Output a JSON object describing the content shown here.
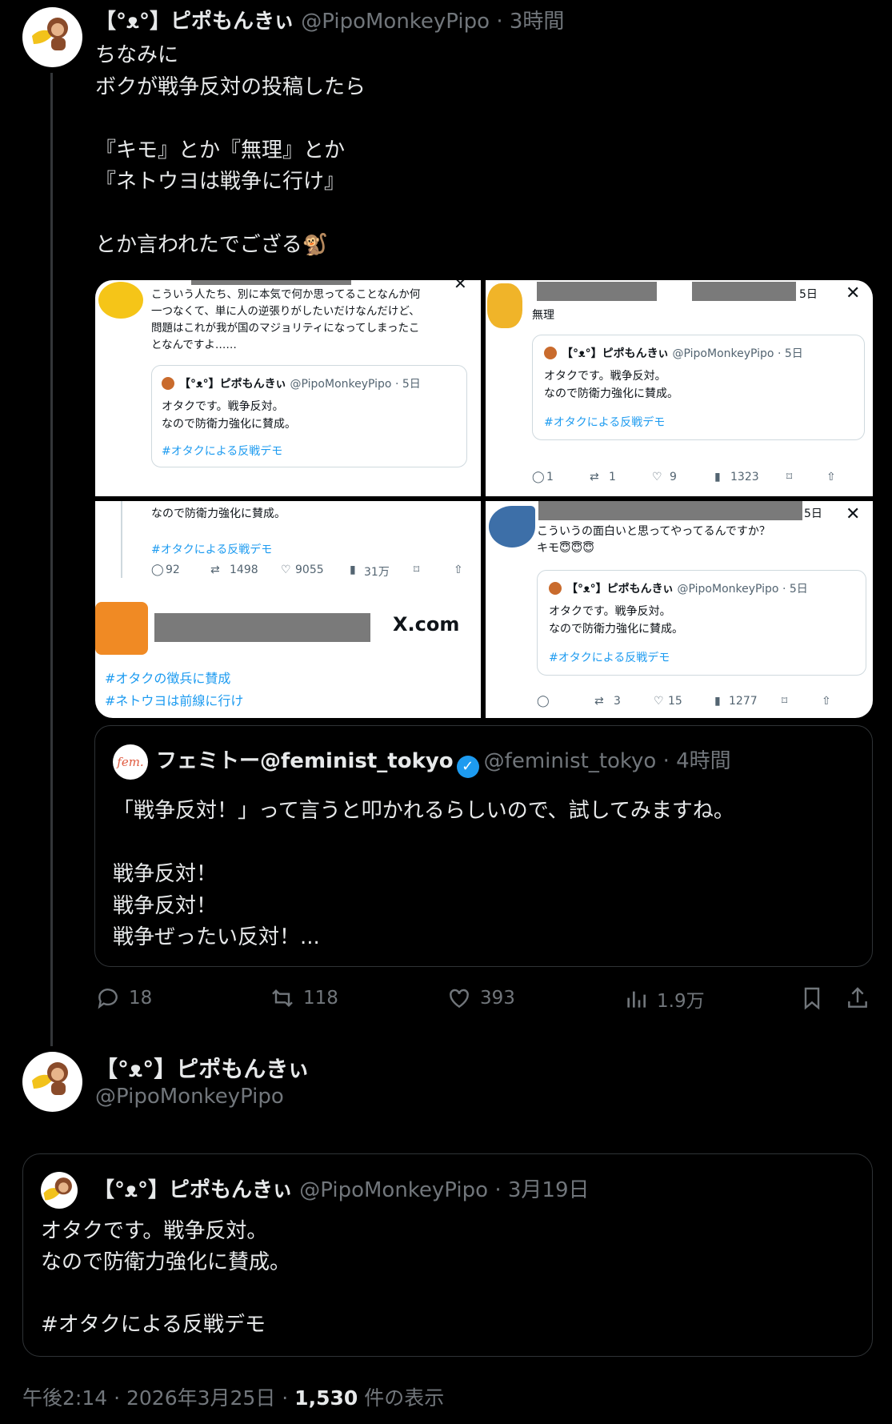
{
  "main_tweet": {
    "display_name": "【°ᴥ°】ピポもんきぃ",
    "handle": "@PipoMonkeyPipo",
    "time": "3時間",
    "text": "ちなみに\nボクが戦争反対の投稿したら\n\n『キモ』とか『無理』とか\n『ネトウヨは戦争に行け』\n\nとか言われたでござる🐒"
  },
  "screenshots": {
    "top_left": {
      "reply_text": "こういう人たち、別に本気で何か思ってることなんか何\n一つなくて、単に人の逆張りがしたいだけなんだけど、\n問題はこれが我が国のマジョリティになってしまったこ\nとなんですよ……",
      "card_name": "【°ᴥ°】ピポもんきぃ",
      "card_handle": "@PipoMonkeyPipo · 5日",
      "card_text": "オタクです。戦争反対。\nなので防衛力強化に賛成。",
      "card_tag": "#オタクによる反戦デモ"
    },
    "top_right": {
      "time": "5日",
      "reply_text": "無理",
      "card_name": "【°ᴥ°】ピポもんきぃ",
      "card_handle": "@PipoMonkeyPipo · 5日",
      "card_text": "オタクです。戦争反対。\nなので防衛力強化に賛成。",
      "card_tag": "#オタクによる反戦デモ",
      "replies": "1",
      "reposts": "1",
      "likes": "9",
      "views": "1323"
    },
    "bottom_left": {
      "text": "なので防衛力強化に賛成。",
      "tag": "#オタクによる反戦デモ",
      "replies": "92",
      "reposts": "1498",
      "likes": "9055",
      "views": "31万",
      "x_label": "X.com",
      "tag1": "#オタクの徴兵に賛成",
      "tag2": "#ネトウヨは前線に行け"
    },
    "bottom_right": {
      "time": "5日",
      "reply_text": "こういうの面白いと思ってやってるんですか？\nキモ😇😇😇",
      "card_name": "【°ᴥ°】ピポもんきぃ",
      "card_handle": "@PipoMonkeyPipo · 5日",
      "card_text": "オタクです。戦争反対。\nなので防衛力強化に賛成。",
      "card_tag": "#オタクによる反戦デモ",
      "reposts": "3",
      "likes": "15",
      "views": "1277"
    }
  },
  "quoted_tweet": {
    "avatar_text": "fem.",
    "display_name": "フェミトー@feminist_tokyo",
    "handle": "@feminist_tokyo",
    "time": "4時間",
    "text": "「戦争反対！」って言うと叩かれるらしいので、試してみますね。\n\n戦争反対！\n戦争反対！\n戦争ぜったい反対！..."
  },
  "stats": {
    "replies": "18",
    "reposts": "118",
    "likes": "393",
    "views": "1.9万"
  },
  "second_tweet": {
    "display_name": "【°ᴥ°】ピポもんきぃ",
    "handle": "@PipoMonkeyPipo",
    "quoted": {
      "display_name": "【°ᴥ°】ピポもんきぃ",
      "handle": "@PipoMonkeyPipo",
      "time": "3月19日",
      "text": "オタクです。戦争反対。\nなので防衛力強化に賛成。\n\n#オタクによる反戦デモ"
    }
  },
  "footer": {
    "time": "午後2:14 · 2026年3月25日 · ",
    "views_count": "1,530",
    "views_label": " 件の表示"
  },
  "colors": {
    "background": "#000000",
    "text": "#e7e9ea",
    "secondary": "#71767b",
    "accent": "#1d9bf0",
    "border": "#2f3336"
  }
}
